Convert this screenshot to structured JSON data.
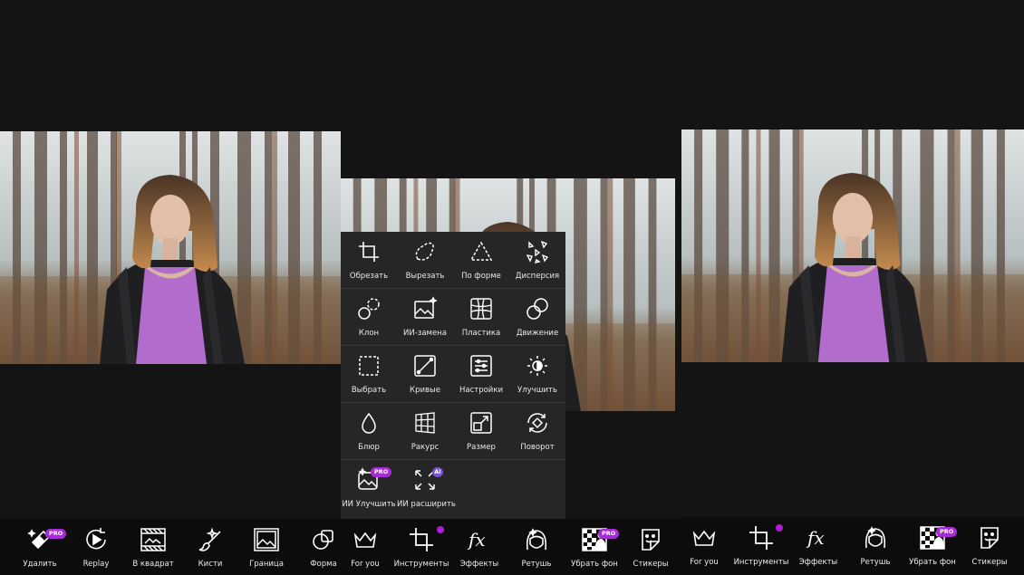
{
  "tools_panel": {
    "rows": [
      [
        {
          "label": "Обрезать",
          "icon": "crop-icon"
        },
        {
          "label": "Вырезать",
          "icon": "cutout-icon"
        },
        {
          "label": "По форме",
          "icon": "shape-crop-icon"
        },
        {
          "label": "Дисперсия",
          "icon": "dispersion-icon"
        }
      ],
      [
        {
          "label": "Клон",
          "icon": "clone-icon"
        },
        {
          "label": "ИИ-замена",
          "icon": "ai-replace-icon"
        },
        {
          "label": "Пластика",
          "icon": "stretch-icon"
        },
        {
          "label": "Движение",
          "icon": "motion-icon"
        }
      ],
      [
        {
          "label": "Выбрать",
          "icon": "select-icon"
        },
        {
          "label": "Кривые",
          "icon": "curves-icon"
        },
        {
          "label": "Настройки",
          "icon": "adjust-icon"
        },
        {
          "label": "Улучшить",
          "icon": "enhance-icon"
        }
      ],
      [
        {
          "label": "Блюр",
          "icon": "blur-icon"
        },
        {
          "label": "Ракурс",
          "icon": "perspective-icon"
        },
        {
          "label": "Размер",
          "icon": "resize-icon"
        },
        {
          "label": "Поворот",
          "icon": "rotate-icon"
        }
      ],
      [
        {
          "label": "ИИ Улучшить",
          "icon": "ai-enhance-icon",
          "badge": "PRO"
        },
        {
          "label": "ИИ расширить",
          "icon": "ai-expand-icon",
          "badge": "AI"
        }
      ]
    ]
  },
  "bottom_bar_left": [
    {
      "label": "Удалить",
      "icon": "eraser-icon",
      "badge": "PRO"
    },
    {
      "label": "Replay",
      "icon": "replay-icon"
    },
    {
      "label": "В квадрат",
      "icon": "square-fit-icon"
    },
    {
      "label": "Кисти",
      "icon": "brush-icon"
    },
    {
      "label": "Граница",
      "icon": "border-icon"
    },
    {
      "label": "Форма",
      "icon": "shape-icon"
    },
    {
      "label": "For you",
      "icon": "crown-icon"
    },
    {
      "label": "Инструменты",
      "icon": "tools-crop-icon",
      "dot": true
    },
    {
      "label": "Эффекты",
      "icon": "fx-icon"
    },
    {
      "label": "Ретушь",
      "icon": "retouch-icon"
    },
    {
      "label": "Убрать фон",
      "icon": "remove-bg-icon",
      "badge": "PRO"
    },
    {
      "label": "Стикеры",
      "icon": "sticker-icon"
    }
  ],
  "bottom_bar_right": [
    {
      "label": "For you",
      "icon": "crown-icon"
    },
    {
      "label": "Инструменты",
      "icon": "tools-crop-icon",
      "dot": true
    },
    {
      "label": "Эффекты",
      "icon": "fx-icon"
    },
    {
      "label": "Ретушь",
      "icon": "retouch-icon"
    },
    {
      "label": "Убрать фон",
      "icon": "remove-bg-icon",
      "badge": "PRO"
    },
    {
      "label": "Стикеры",
      "icon": "sticker-icon"
    }
  ],
  "colors": {
    "background": "#141414",
    "panel": "#262626",
    "accent_pro": "#a82ad9",
    "notification_dot": "#b21cd6"
  }
}
